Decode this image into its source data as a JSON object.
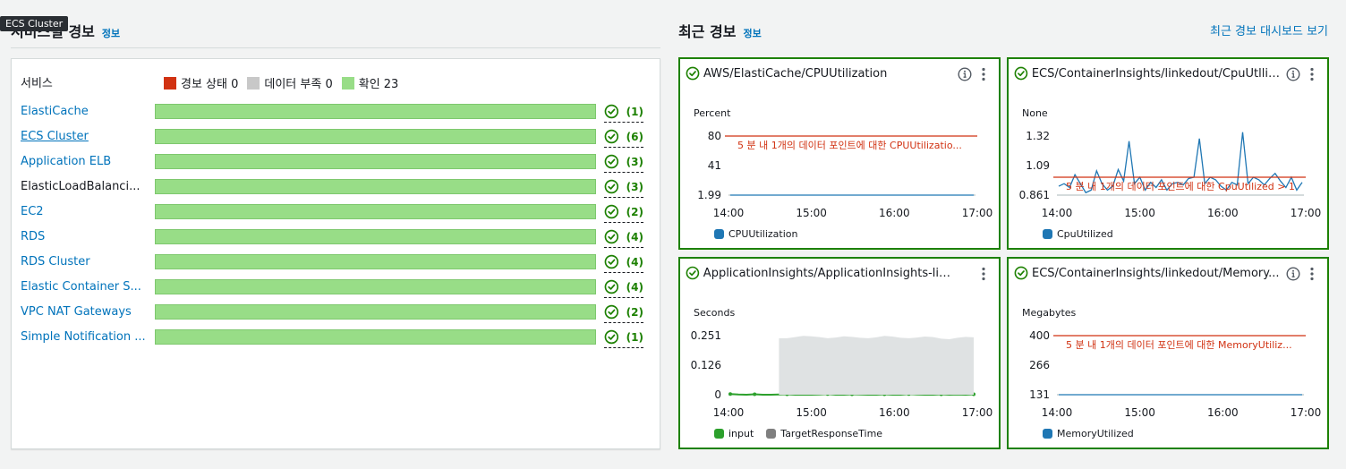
{
  "tooltip": "ECS Cluster",
  "left": {
    "title": "서비스별 경보",
    "info": "정보",
    "service_col": "서비스",
    "legend": [
      {
        "label": "경보 상태 0",
        "color": "#d13212"
      },
      {
        "label": "데이터 부족 0",
        "color": "#c8c8c8"
      },
      {
        "label": "확인 23",
        "color": "#98dd87"
      }
    ],
    "services": [
      {
        "name": "ElastiCache",
        "count": "(1)",
        "link": true
      },
      {
        "name": "ECS Cluster",
        "count": "(6)",
        "link": true
      },
      {
        "name": "Application ELB",
        "count": "(3)",
        "link": true
      },
      {
        "name": "ElasticLoadBalanci...",
        "count": "(3)",
        "link": false
      },
      {
        "name": "EC2",
        "count": "(2)",
        "link": true
      },
      {
        "name": "RDS",
        "count": "(4)",
        "link": true
      },
      {
        "name": "RDS Cluster",
        "count": "(4)",
        "link": true
      },
      {
        "name": "Elastic Container S...",
        "count": "(4)",
        "link": true
      },
      {
        "name": "VPC NAT Gateways",
        "count": "(2)",
        "link": true
      },
      {
        "name": "Simple Notification ...",
        "count": "(1)",
        "link": true
      }
    ]
  },
  "right": {
    "title": "최근 경보",
    "info": "정보",
    "dashboard_link": "최근 경보 대시보드 보기"
  },
  "colors": {
    "ok_green": "#1d8102",
    "threshold_red": "#d13212",
    "series_blue": "#1f77b4",
    "series_green": "#2ca02c",
    "series_gray": "#7f7f7f"
  },
  "cards": [
    {
      "title": "AWS/ElastiCache/CPUUtilization",
      "has_info": true,
      "unit": "Percent",
      "chart_data": {
        "type": "line",
        "x_ticks": [
          "14:00",
          "15:00",
          "16:00",
          "17:00"
        ],
        "y_ticks": [
          "80",
          "41",
          "1.99"
        ],
        "ylim": [
          1.99,
          80
        ],
        "threshold": {
          "value": 80,
          "label": "5 분 내 1개의 데이터 포인트에 대한 CPUUtilizatio..."
        },
        "series": [
          {
            "name": "CPUUtilization",
            "color": "#1f77b4",
            "values": [
              1.99,
              1.99,
              1.99,
              1.99,
              1.99,
              1.99,
              1.99,
              1.99,
              1.99,
              1.99,
              1.99,
              1.99,
              1.99,
              1.99,
              1.99,
              1.99,
              1.99,
              1.99,
              1.99,
              1.99,
              1.99,
              1.99,
              1.99,
              1.99,
              1.99,
              1.99,
              1.99,
              1.99,
              1.99,
              1.99,
              1.99,
              1.99,
              1.99,
              1.99,
              1.99,
              1.99,
              1.99,
              1.99,
              1.99,
              1.99,
              1.99
            ]
          }
        ]
      }
    },
    {
      "title": "ECS/ContainerInsights/linkedout/CpuUtlliz...",
      "has_info": true,
      "unit": "None",
      "chart_data": {
        "type": "line",
        "x_ticks": [
          "14:00",
          "15:00",
          "16:00",
          "17:00"
        ],
        "y_ticks": [
          "1.32",
          "1.09",
          "0.861"
        ],
        "ylim": [
          0.861,
          1.32
        ],
        "threshold": {
          "value": 1,
          "label": "5 분 내 1개의 데이터 포인트에 대한 CpuUtilized > 1"
        },
        "series": [
          {
            "name": "CpuUtilized",
            "color": "#1f77b4",
            "values": [
              0.93,
              0.95,
              0.92,
              1.02,
              0.95,
              0.88,
              0.9,
              1.05,
              0.95,
              0.9,
              0.93,
              1.06,
              0.97,
              1.28,
              0.95,
              1.0,
              0.9,
              0.96,
              0.92,
              0.98,
              0.9,
              0.95,
              0.96,
              0.94,
              0.99,
              1.0,
              1.3,
              0.95,
              1.0,
              0.98,
              0.93,
              0.9,
              0.96,
              0.94,
              1.35,
              0.95,
              1.0,
              0.98,
              0.94,
              0.99,
              1.03,
              0.97,
              0.92,
              1.0,
              0.9,
              0.96
            ]
          }
        ]
      }
    },
    {
      "title": "ApplicationInsights/ApplicationInsights-lin...",
      "has_info": false,
      "unit": "Seconds",
      "chart_data": {
        "type": "area",
        "x_ticks": [
          "14:00",
          "15:00",
          "16:00",
          "17:00"
        ],
        "y_ticks": [
          "0.251",
          "0.126",
          "0"
        ],
        "ylim": [
          0,
          0.251
        ],
        "series": [
          {
            "name": "input",
            "color": "#2ca02c",
            "values": [
              0.003,
              0.001,
              0,
              0.002,
              0,
              0,
              0.001,
              0.002,
              0,
              0,
              0,
              0.001,
              0.003,
              0,
              0,
              0.002,
              0.001,
              0,
              0,
              0.002,
              0,
              0,
              0.003,
              0.001,
              0,
              0,
              0.002,
              0,
              0.001,
              0,
              0.002
            ]
          },
          {
            "name": "TargetResponseTime",
            "color": "#7f7f7f",
            "values": [
              null,
              null,
              null,
              null,
              null,
              null,
              0.24,
              0.24,
              0.245,
              0.25,
              0.248,
              0.245,
              0.24,
              0.243,
              0.248,
              0.246,
              0.242,
              0.24,
              0.244,
              0.25,
              0.247,
              0.242,
              0.24,
              0.243,
              0.247,
              0.245,
              0.238,
              0.236,
              0.242,
              0.246,
              0.244
            ]
          }
        ]
      }
    },
    {
      "title": "ECS/ContainerInsights/linkedout/Memory...",
      "has_info": true,
      "unit": "Megabytes",
      "chart_data": {
        "type": "line",
        "x_ticks": [
          "14:00",
          "15:00",
          "16:00",
          "17:00"
        ],
        "y_ticks": [
          "400",
          "266",
          "131"
        ],
        "ylim": [
          131,
          400
        ],
        "threshold": {
          "value": 400,
          "label": "5 분 내 1개의 데이터 포인트에 대한 MemoryUtiliz..."
        },
        "series": [
          {
            "name": "MemoryUtilized",
            "color": "#1f77b4",
            "values": [
              131,
              131,
              131,
              131,
              131,
              131,
              131,
              131,
              131,
              131,
              131,
              131,
              131,
              131,
              131,
              131,
              131,
              131,
              131,
              131,
              131,
              131,
              131,
              131,
              131,
              131,
              131,
              131,
              131,
              131,
              131
            ]
          }
        ]
      }
    }
  ]
}
